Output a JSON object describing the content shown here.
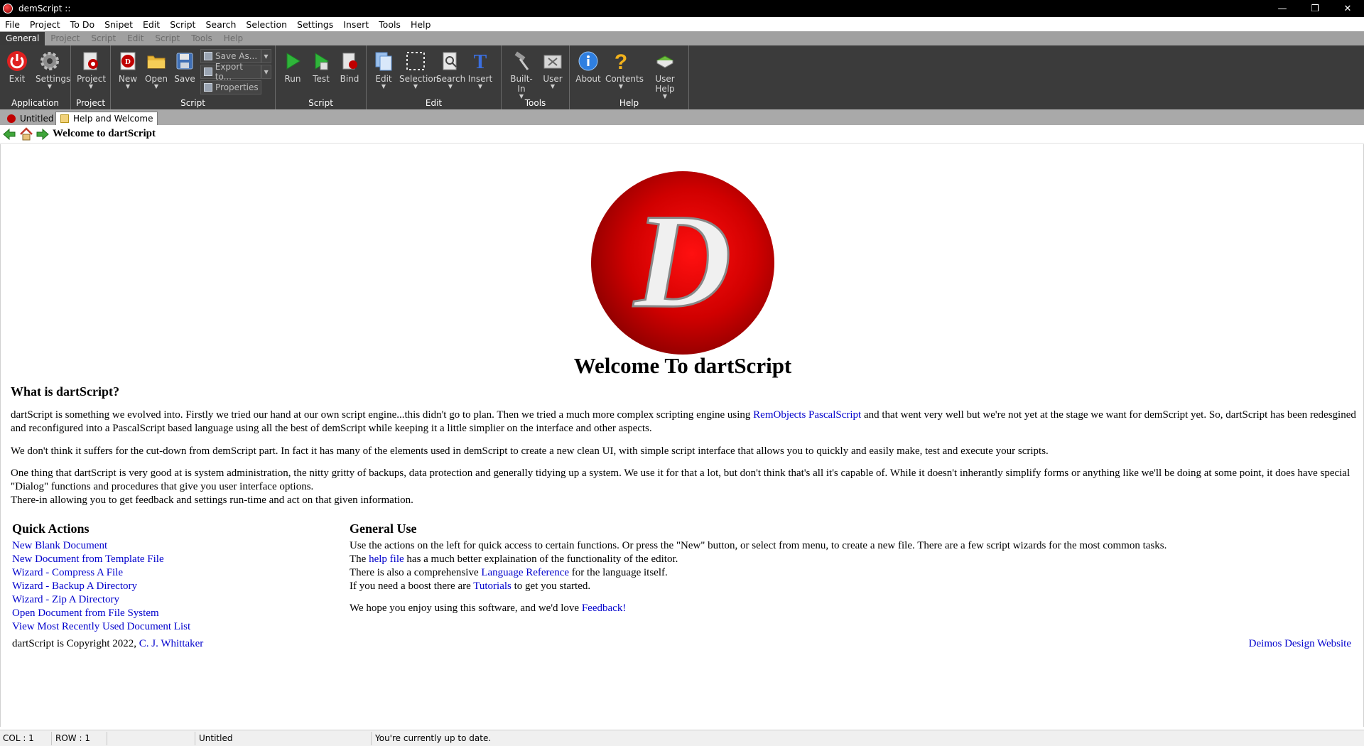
{
  "window": {
    "title": "demScript ::",
    "buttons": [
      "—",
      "❐",
      "✕"
    ]
  },
  "menu": [
    "File",
    "Project",
    "To Do",
    "Snipet",
    "Edit",
    "Script",
    "Search",
    "Selection",
    "Settings",
    "Insert",
    "Tools",
    "Help"
  ],
  "ribbon_tabs": [
    "General",
    "Project",
    "Script",
    "Edit",
    "Script",
    "Tools",
    "Help"
  ],
  "ribbon": {
    "exit": "Exit",
    "settings": "Settings",
    "application": "Application",
    "project": "Project",
    "project_group": "Project",
    "new": "New",
    "open": "Open",
    "save": "Save",
    "save_as": "Save As...",
    "export_to": "Export to...",
    "properties": "Properties",
    "script_group": "Script",
    "run": "Run",
    "test": "Test",
    "bind": "Bind",
    "script_group2": "Script",
    "edit": "Edit",
    "selection": "Selection",
    "search": "Search",
    "insert": "Insert",
    "edit_group": "Edit",
    "builtin": "Built-In",
    "user": "User",
    "tools_group": "Tools",
    "about": "About",
    "contents": "Contents",
    "user_help": "User Help",
    "help_group": "Help"
  },
  "doc_tabs": {
    "untitled": "Untitled",
    "help": "Help and Welcome"
  },
  "nav": {
    "page_title": "Welcome to dartScript"
  },
  "content": {
    "heading": "Welcome To dartScript",
    "what_heading": "What is dartScript?",
    "p1a": "dartScript is something we evolved into. Firstly we tried our hand at our own script engine...this didn't go to plan. Then we tried a much more complex scripting engine using ",
    "p1_link": "RemObjects PascalScript",
    "p1b": " and that went very well but we're not yet at the stage we want for demScript yet. So, dartScript has been redesgined and reconfigured into a PascalScript based language using all the best of demScript while keeping it a little simplier on the interface and other aspects.",
    "p2": "We don't think it suffers for the cut-down from demScript part. In fact it has many of the elements used in demScript to create a new clean UI, with simple script interface that allows you to quickly and easily make, test and execute your scripts.",
    "p3a": "One thing that dartScript is very good at is system administration, the nitty gritty of backups, data protection and generally tidying up a system. We use it for that a lot, but don't think that's all it's capable of. While it doesn't inherantly simplify forms or anything like we'll be doing at some point, it does have special \"Dialog\" functions and procedures that give you user interface options.",
    "p3b": "There-in allowing you to get feedback and settings run-time and act on that given information.",
    "qa_heading": "Quick Actions",
    "quick_actions": [
      "New Blank Document",
      "New Document from Template File",
      "Wizard - Compress A File",
      "Wizard - Backup A Directory",
      "Wizard - Zip A Directory",
      "Open Document from File System",
      "View Most Recently Used Document List"
    ],
    "gu_heading": "General Use",
    "gu1": "Use the actions on the left for quick access to certain functions. Or press the \"New\" button, or select from menu, to create a new file. There are a few script wizards for the most common tasks.",
    "gu2a": "The ",
    "gu2_link": "help file",
    "gu2b": " has a much better explaination of the functionality of the editor.",
    "gu3a": "There is also a comprehensive ",
    "gu3_link": "Language Reference",
    "gu3b": " for the language itself.",
    "gu4a": "If you need a boost there are ",
    "gu4_link": "Tutorials",
    "gu4b": " to get you started.",
    "gu5a": "We hope you enjoy using this software, and we'd love ",
    "gu5_link": "Feedback!",
    "copyright": "dartScript is Copyright 2022, ",
    "copyright_link": "C. J. Whittaker",
    "deimos_link": "Deimos Design Website"
  },
  "status": {
    "col": "COL : 1",
    "row": "ROW : 1",
    "doc": "Untitled",
    "message": "You're currently up to date."
  },
  "colors": {
    "ribbon_bg": "#3b3b3b",
    "link": "#0000cc",
    "logo_red": "#d00000"
  }
}
